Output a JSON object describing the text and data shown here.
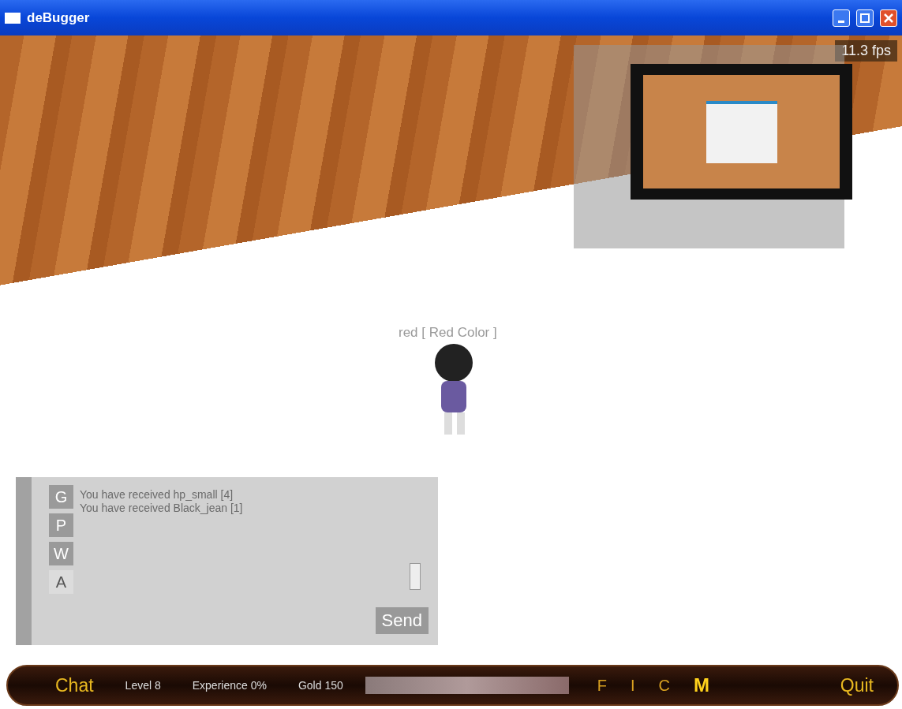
{
  "window": {
    "title": "deBugger"
  },
  "fps": "11.3 fps",
  "player_tag": "red [ Red Color ]",
  "chat": {
    "tabs": [
      {
        "label": "G",
        "selected": false
      },
      {
        "label": "P",
        "selected": false
      },
      {
        "label": "W",
        "selected": false
      },
      {
        "label": "A",
        "selected": true
      }
    ],
    "messages": [
      "You have received hp_small [4]",
      "You have received Black_jean [1]"
    ],
    "send": "Send"
  },
  "hud": {
    "chat": "Chat",
    "stats": [
      "Level 8",
      "Experience 0%",
      "Gold 150"
    ],
    "menu": [
      {
        "label": "F",
        "selected": false
      },
      {
        "label": "I",
        "selected": false
      },
      {
        "label": "C",
        "selected": false
      },
      {
        "label": "M",
        "selected": true
      }
    ],
    "quit": "Quit"
  }
}
